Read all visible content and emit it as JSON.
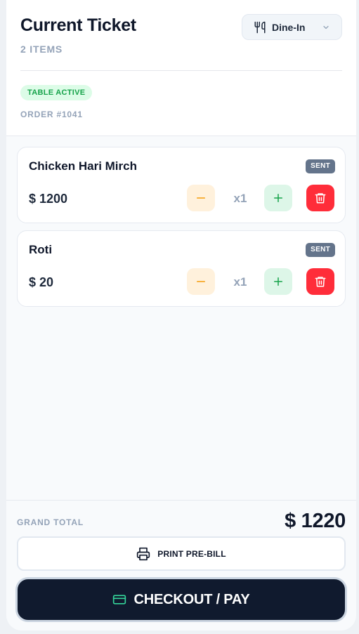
{
  "header": {
    "title": "Current Ticket",
    "items_count": "2 ITEMS",
    "order_type": {
      "selected": "Dine-In",
      "icon": "fork-knife-icon"
    },
    "table_status": "TABLE ACTIVE",
    "order_number": "ORDER #1041"
  },
  "items": [
    {
      "name": "Chicken Hari Mirch",
      "status": "SENT",
      "price": "$ 1200",
      "qty": "x1"
    },
    {
      "name": "Roti",
      "status": "SENT",
      "price": "$ 20",
      "qty": "x1"
    }
  ],
  "footer": {
    "grand_total_label": "GRAND TOTAL",
    "grand_total_value": "$ 1220",
    "print_label": "PRINT PRE-BILL",
    "checkout_label": "CHECKOUT / PAY"
  },
  "colors": {
    "accent_green": "#16a34a",
    "danger": "#ff2d3a",
    "minus_orange": "#f59e0b",
    "dark": "#101a2e"
  }
}
